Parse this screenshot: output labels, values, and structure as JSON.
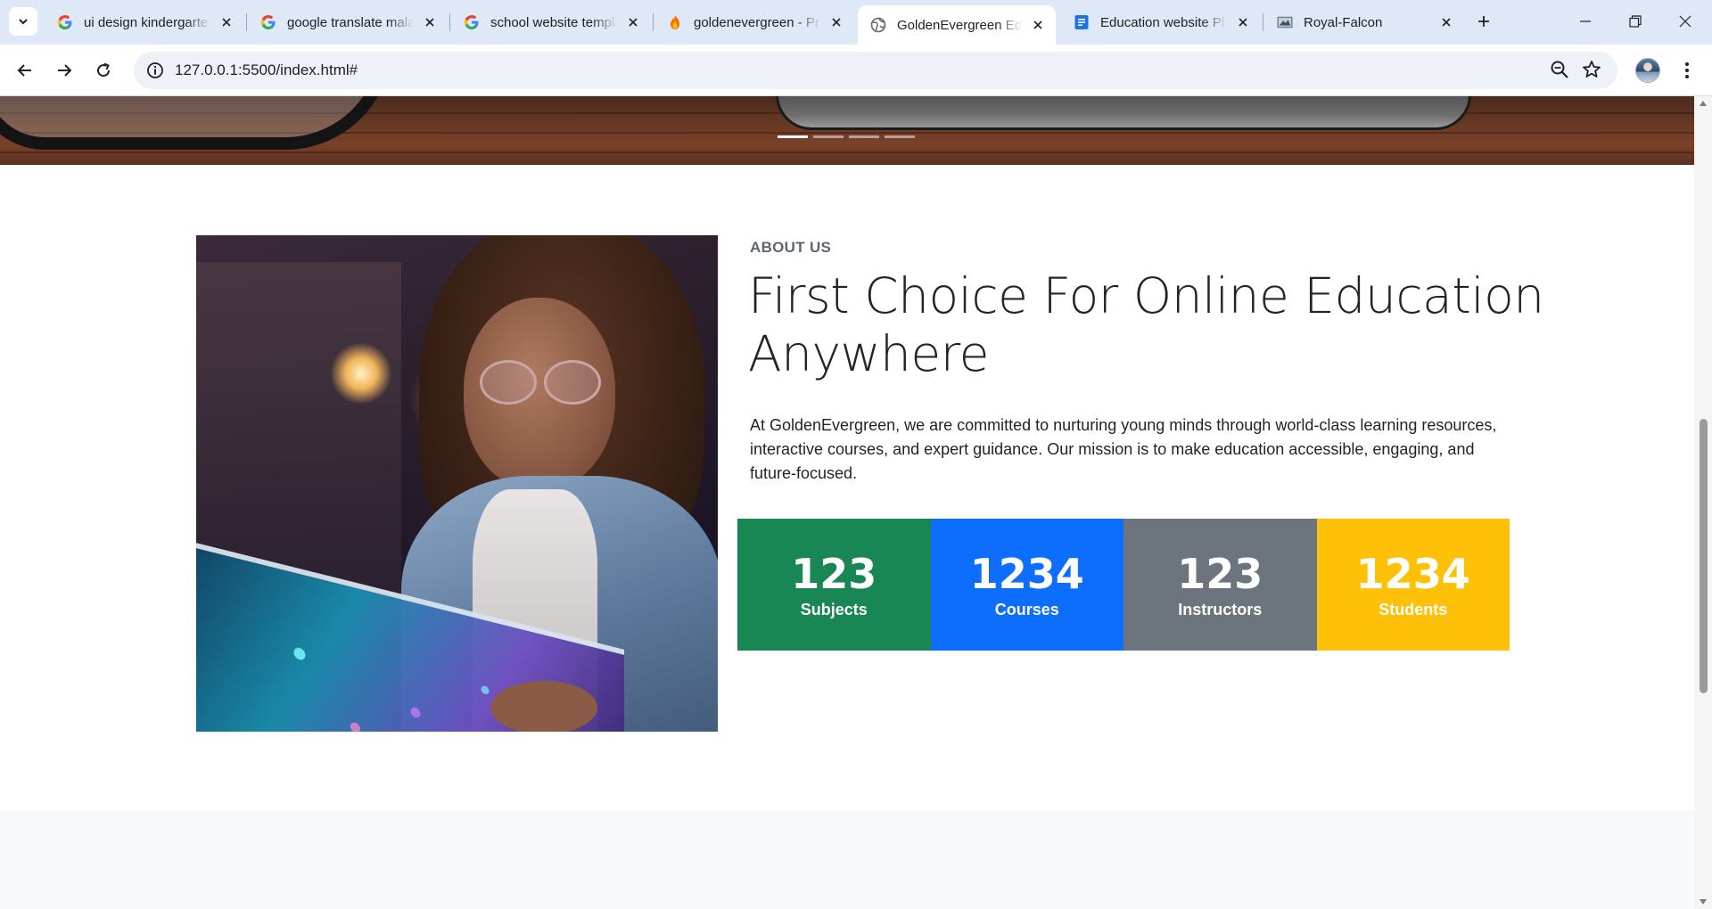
{
  "browser": {
    "tabs": [
      {
        "title": "ui design kindergarten",
        "favicon": "google-g-icon",
        "active": false
      },
      {
        "title": "google translate malayalam",
        "favicon": "google-g-icon",
        "active": false
      },
      {
        "title": "school website template",
        "favicon": "google-g-icon",
        "active": false
      },
      {
        "title": "goldenevergreen - Project",
        "favicon": "firebase-flame-icon",
        "active": false
      },
      {
        "title": "GoldenEvergreen Education",
        "favicon": "globe-icon",
        "active": true
      },
      {
        "title": "Education website Planning",
        "favicon": "docs-icon",
        "active": false
      },
      {
        "title": "Royal-Falcon",
        "favicon": "image-favicon-icon",
        "active": false
      }
    ],
    "url": "127.0.0.1:5500/index.html#"
  },
  "hero": {
    "slide_count": 4,
    "active_slide": 1
  },
  "about": {
    "kicker": "ABOUT US",
    "title": "First Choice For Online Education Anywhere",
    "description": "At GoldenEvergreen, we are committed to nurturing young minds through world-class learning resources, interactive courses, and expert guidance. Our mission is to make education accessible, engaging, and future-focused.",
    "stats": [
      {
        "value": "123",
        "label": "Subjects",
        "color": "#198754"
      },
      {
        "value": "1234",
        "label": "Courses",
        "color": "#0d6efd"
      },
      {
        "value": "123",
        "label": "Instructors",
        "color": "#6c757d"
      },
      {
        "value": "1234",
        "label": "Students",
        "color": "#ffc107"
      }
    ]
  },
  "colors": {
    "tabbar": "#dfe8f6",
    "success": "#198754",
    "primary": "#0d6efd",
    "secondary": "#6c757d",
    "warning": "#ffc107"
  }
}
